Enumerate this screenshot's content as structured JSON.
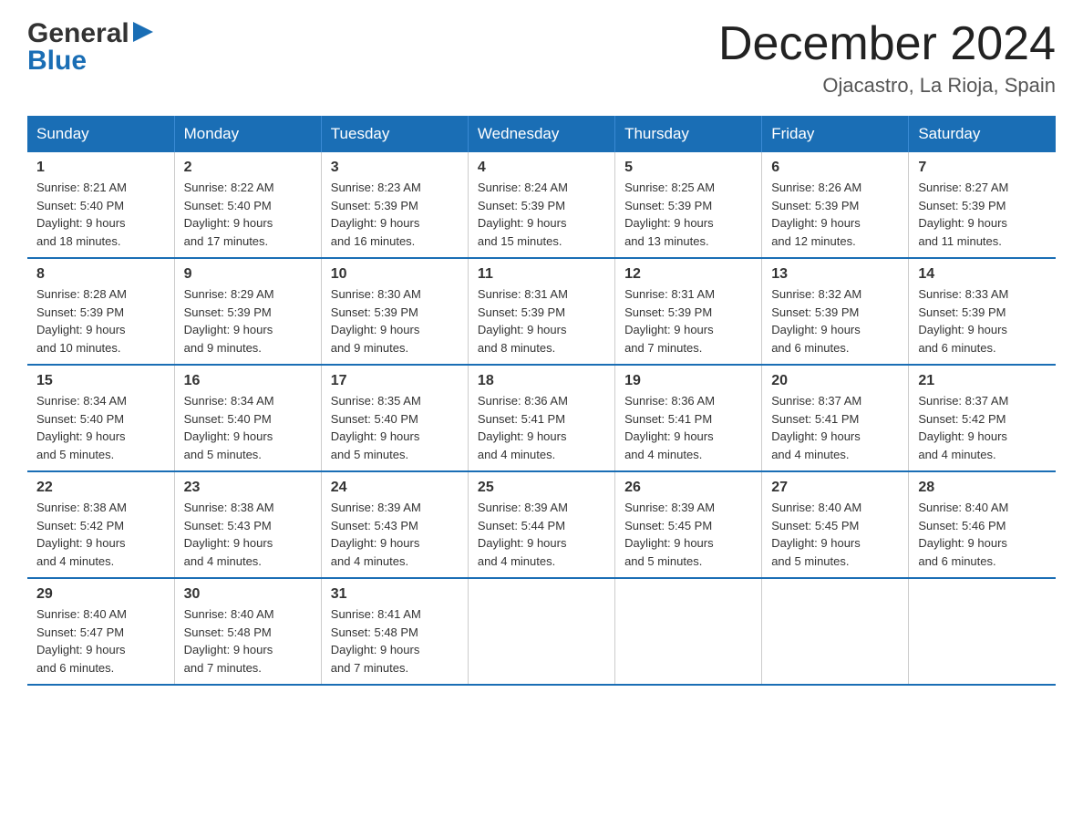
{
  "logo": {
    "general": "General",
    "blue": "Blue"
  },
  "title": {
    "month_year": "December 2024",
    "location": "Ojacastro, La Rioja, Spain"
  },
  "days_of_week": [
    "Sunday",
    "Monday",
    "Tuesday",
    "Wednesday",
    "Thursday",
    "Friday",
    "Saturday"
  ],
  "weeks": [
    [
      {
        "day": "1",
        "sunrise": "8:21 AM",
        "sunset": "5:40 PM",
        "daylight": "9 hours and 18 minutes."
      },
      {
        "day": "2",
        "sunrise": "8:22 AM",
        "sunset": "5:40 PM",
        "daylight": "9 hours and 17 minutes."
      },
      {
        "day": "3",
        "sunrise": "8:23 AM",
        "sunset": "5:39 PM",
        "daylight": "9 hours and 16 minutes."
      },
      {
        "day": "4",
        "sunrise": "8:24 AM",
        "sunset": "5:39 PM",
        "daylight": "9 hours and 15 minutes."
      },
      {
        "day": "5",
        "sunrise": "8:25 AM",
        "sunset": "5:39 PM",
        "daylight": "9 hours and 13 minutes."
      },
      {
        "day": "6",
        "sunrise": "8:26 AM",
        "sunset": "5:39 PM",
        "daylight": "9 hours and 12 minutes."
      },
      {
        "day": "7",
        "sunrise": "8:27 AM",
        "sunset": "5:39 PM",
        "daylight": "9 hours and 11 minutes."
      }
    ],
    [
      {
        "day": "8",
        "sunrise": "8:28 AM",
        "sunset": "5:39 PM",
        "daylight": "9 hours and 10 minutes."
      },
      {
        "day": "9",
        "sunrise": "8:29 AM",
        "sunset": "5:39 PM",
        "daylight": "9 hours and 9 minutes."
      },
      {
        "day": "10",
        "sunrise": "8:30 AM",
        "sunset": "5:39 PM",
        "daylight": "9 hours and 9 minutes."
      },
      {
        "day": "11",
        "sunrise": "8:31 AM",
        "sunset": "5:39 PM",
        "daylight": "9 hours and 8 minutes."
      },
      {
        "day": "12",
        "sunrise": "8:31 AM",
        "sunset": "5:39 PM",
        "daylight": "9 hours and 7 minutes."
      },
      {
        "day": "13",
        "sunrise": "8:32 AM",
        "sunset": "5:39 PM",
        "daylight": "9 hours and 6 minutes."
      },
      {
        "day": "14",
        "sunrise": "8:33 AM",
        "sunset": "5:39 PM",
        "daylight": "9 hours and 6 minutes."
      }
    ],
    [
      {
        "day": "15",
        "sunrise": "8:34 AM",
        "sunset": "5:40 PM",
        "daylight": "9 hours and 5 minutes."
      },
      {
        "day": "16",
        "sunrise": "8:34 AM",
        "sunset": "5:40 PM",
        "daylight": "9 hours and 5 minutes."
      },
      {
        "day": "17",
        "sunrise": "8:35 AM",
        "sunset": "5:40 PM",
        "daylight": "9 hours and 5 minutes."
      },
      {
        "day": "18",
        "sunrise": "8:36 AM",
        "sunset": "5:41 PM",
        "daylight": "9 hours and 4 minutes."
      },
      {
        "day": "19",
        "sunrise": "8:36 AM",
        "sunset": "5:41 PM",
        "daylight": "9 hours and 4 minutes."
      },
      {
        "day": "20",
        "sunrise": "8:37 AM",
        "sunset": "5:41 PM",
        "daylight": "9 hours and 4 minutes."
      },
      {
        "day": "21",
        "sunrise": "8:37 AM",
        "sunset": "5:42 PM",
        "daylight": "9 hours and 4 minutes."
      }
    ],
    [
      {
        "day": "22",
        "sunrise": "8:38 AM",
        "sunset": "5:42 PM",
        "daylight": "9 hours and 4 minutes."
      },
      {
        "day": "23",
        "sunrise": "8:38 AM",
        "sunset": "5:43 PM",
        "daylight": "9 hours and 4 minutes."
      },
      {
        "day": "24",
        "sunrise": "8:39 AM",
        "sunset": "5:43 PM",
        "daylight": "9 hours and 4 minutes."
      },
      {
        "day": "25",
        "sunrise": "8:39 AM",
        "sunset": "5:44 PM",
        "daylight": "9 hours and 4 minutes."
      },
      {
        "day": "26",
        "sunrise": "8:39 AM",
        "sunset": "5:45 PM",
        "daylight": "9 hours and 5 minutes."
      },
      {
        "day": "27",
        "sunrise": "8:40 AM",
        "sunset": "5:45 PM",
        "daylight": "9 hours and 5 minutes."
      },
      {
        "day": "28",
        "sunrise": "8:40 AM",
        "sunset": "5:46 PM",
        "daylight": "9 hours and 6 minutes."
      }
    ],
    [
      {
        "day": "29",
        "sunrise": "8:40 AM",
        "sunset": "5:47 PM",
        "daylight": "9 hours and 6 minutes."
      },
      {
        "day": "30",
        "sunrise": "8:40 AM",
        "sunset": "5:48 PM",
        "daylight": "9 hours and 7 minutes."
      },
      {
        "day": "31",
        "sunrise": "8:41 AM",
        "sunset": "5:48 PM",
        "daylight": "9 hours and 7 minutes."
      },
      null,
      null,
      null,
      null
    ]
  ],
  "labels": {
    "sunrise": "Sunrise:",
    "sunset": "Sunset:",
    "daylight": "Daylight:"
  }
}
